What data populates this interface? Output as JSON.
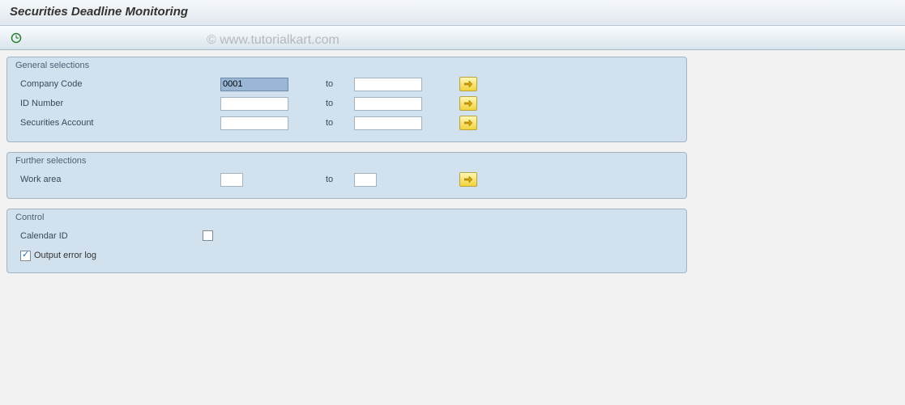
{
  "header": {
    "title": "Securities Deadline Monitoring"
  },
  "watermark": "© www.tutorialkart.com",
  "general": {
    "title": "General selections",
    "company_code_label": "Company Code",
    "company_code_from": "0001",
    "company_code_to": "",
    "id_number_label": "ID Number",
    "id_number_from": "",
    "id_number_to": "",
    "securities_account_label": "Securities Account",
    "securities_account_from": "",
    "securities_account_to": "",
    "to_label": "to"
  },
  "further": {
    "title": "Further selections",
    "work_area_label": "Work area",
    "work_area_from": "",
    "work_area_to": "",
    "to_label": "to"
  },
  "control": {
    "title": "Control",
    "calendar_id_label": "Calendar ID",
    "output_error_log_label": "Output error log",
    "output_error_log_checked": true
  }
}
